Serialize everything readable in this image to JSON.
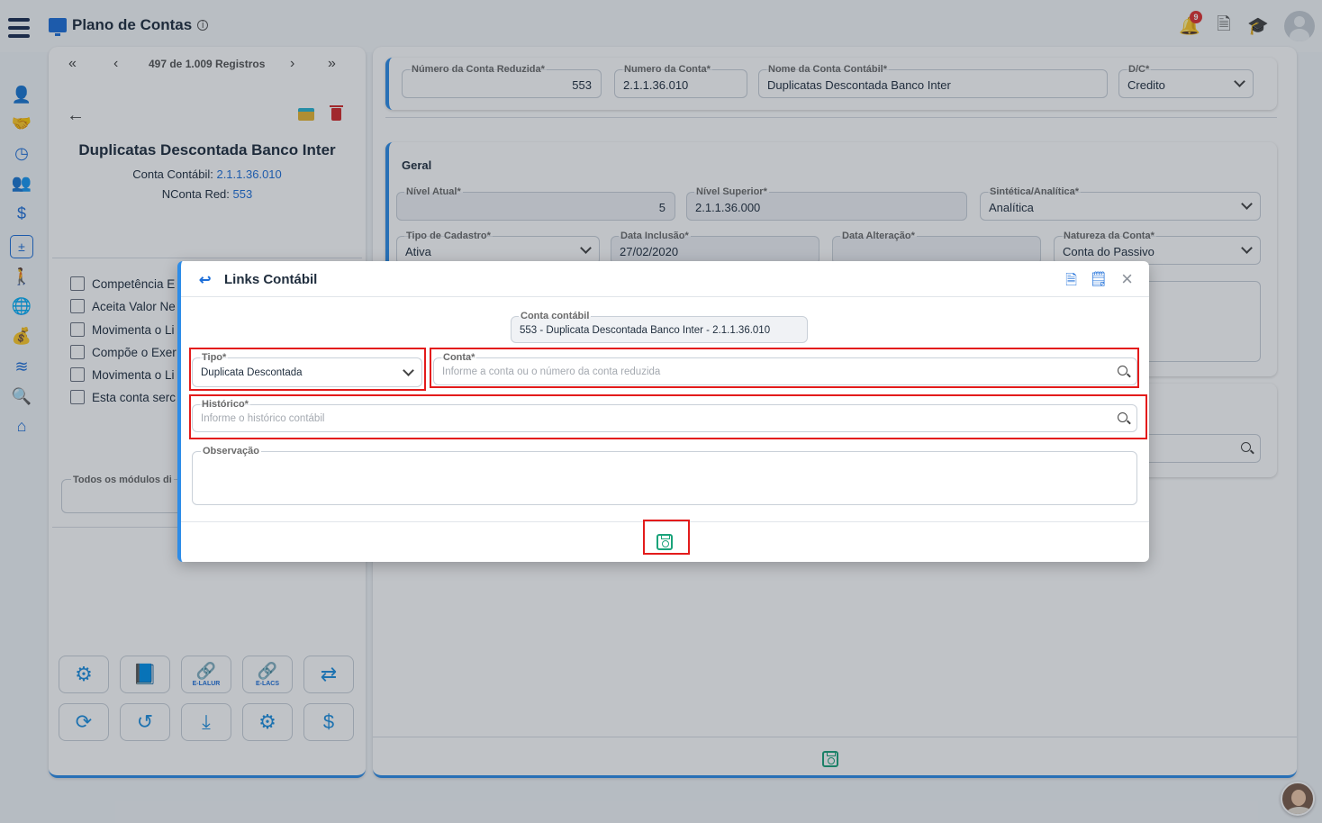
{
  "header": {
    "title": "Plano de Contas",
    "notification_count": "9"
  },
  "record": {
    "pager_text": "497 de 1.009 Registros",
    "title": "Duplicatas Descontada Banco Inter",
    "conta_contabil_label": "Conta Contábil:",
    "conta_contabil_value": "2.1.1.36.010",
    "nconta_label": "NConta Red:",
    "nconta_value": "553",
    "checkboxes": [
      "Competência E",
      "Aceita Valor Ne",
      "Movimenta o Li",
      "Compõe o Exer",
      "Movimenta o Li",
      "Esta conta serc"
    ],
    "modules_label": "Todos os módulos di",
    "tool_labels": {
      "elalur": "E-LALUR",
      "elacs": "E-LACS"
    }
  },
  "form": {
    "numero_reduzida": {
      "label": "Número da Conta Reduzida*",
      "value": "553"
    },
    "numero_conta": {
      "label": "Numero da Conta*",
      "value": "2.1.1.36.010"
    },
    "nome_conta": {
      "label": "Nome da Conta Contábil*",
      "value": "Duplicatas Descontada Banco Inter"
    },
    "dc": {
      "label": "D/C*",
      "value": "Credito"
    },
    "section_geral": "Geral",
    "nivel_atual": {
      "label": "Nível Atual*",
      "value": "5"
    },
    "nivel_superior": {
      "label": "Nível Superior*",
      "value": "2.1.1.36.000"
    },
    "sintetica": {
      "label": "Sintética/Analítica*",
      "value": "Analítica"
    },
    "tipo_cadastro": {
      "label": "Tipo de Cadastro*",
      "value": "Ativa"
    },
    "data_inclusao": {
      "label": "Data Inclusão*",
      "value": "27/02/2020"
    },
    "data_alteracao": {
      "label": "Data Alteração*",
      "value": ""
    },
    "natureza": {
      "label": "Natureza da Conta*",
      "value": "Conta do Passivo"
    }
  },
  "modal": {
    "title": "Links Contábil",
    "conta_contabil": {
      "label": "Conta contábil",
      "value": "553 - Duplicata Descontada Banco Inter  - 2.1.1.36.010"
    },
    "tipo": {
      "label": "Tipo*",
      "value": "Duplicata Descontada"
    },
    "conta": {
      "label": "Conta*",
      "placeholder": "Informe a conta ou o número da conta reduzida"
    },
    "historico": {
      "label": "Histórico*",
      "placeholder": "Informe o histórico contábil"
    },
    "observacao": {
      "label": "Observação"
    }
  },
  "colors": {
    "accent": "#2d8ce8",
    "highlight": "#e31b1b",
    "save": "#1aa37a",
    "danger": "#d42a2a"
  }
}
